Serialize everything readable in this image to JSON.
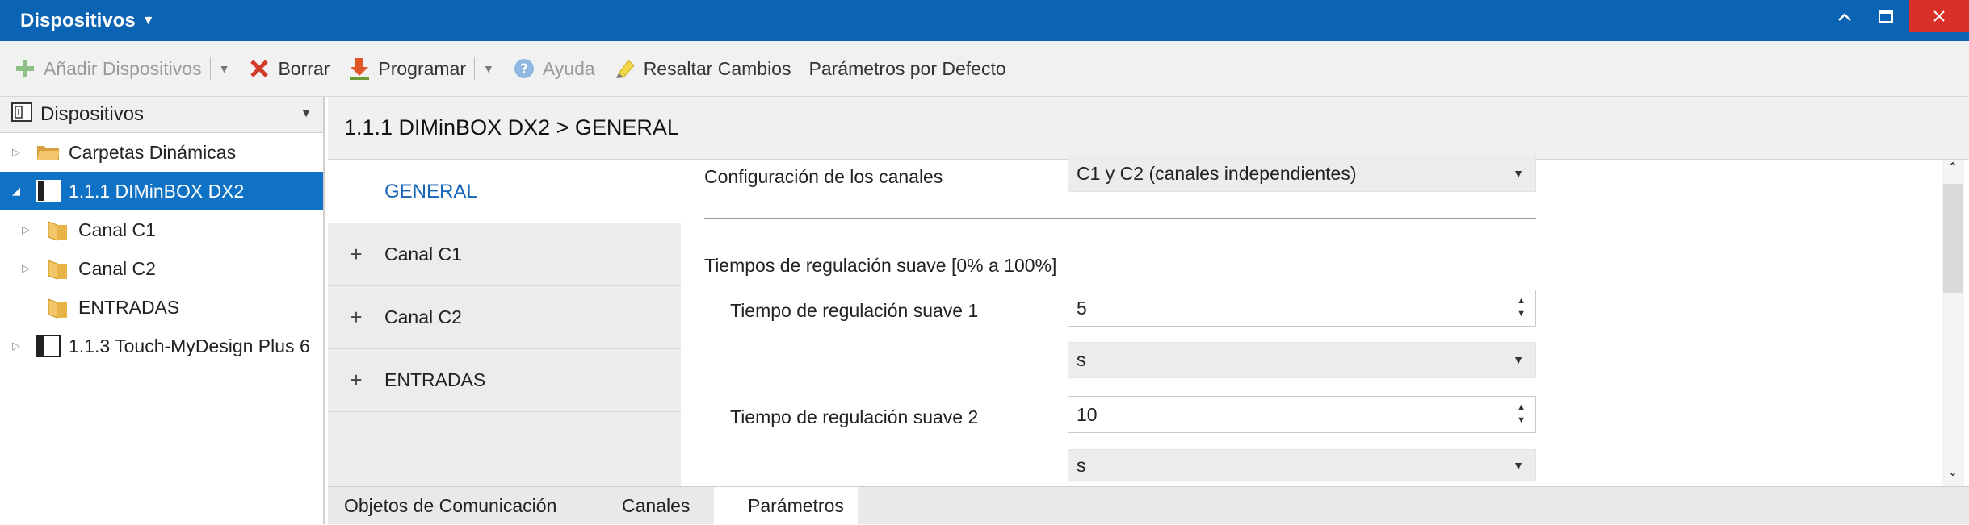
{
  "window": {
    "title": "Dispositivos",
    "controls": {
      "minimize": "⌃",
      "maximize": "☐",
      "close": "✕"
    }
  },
  "toolbar": {
    "add_devices": "Añadir Dispositivos",
    "delete": "Borrar",
    "program": "Programar",
    "help": "Ayuda",
    "highlight_changes": "Resaltar Cambios",
    "default_params": "Parámetros por Defecto"
  },
  "sidebar": {
    "header": "Dispositivos",
    "items": [
      {
        "label": "Carpetas Dinámicas",
        "icon": "folder-open-icon"
      },
      {
        "label": "1.1.1 DIMinBOX DX2",
        "icon": "device-icon",
        "selected": true
      },
      {
        "label": "Canal C1",
        "icon": "folder-icon"
      },
      {
        "label": "Canal C2",
        "icon": "folder-icon"
      },
      {
        "label": "ENTRADAS",
        "icon": "folder-icon"
      },
      {
        "label": "1.1.3 Touch-MyDesign Plus 6",
        "icon": "device-icon"
      }
    ]
  },
  "breadcrumb": "1.1.1 DIMinBOX DX2 > GENERAL",
  "nav": {
    "general": "GENERAL",
    "items": [
      "Canal C1",
      "Canal C2",
      "ENTRADAS"
    ]
  },
  "params": {
    "channels_config_label": "Configuración de los canales",
    "channels_config_value": "C1 y C2 (canales independientes)",
    "soft_dimming_section": "Tiempos de regulación suave [0% a 100%]",
    "soft_time_1_label": "Tiempo de regulación suave 1",
    "soft_time_1_value": "5",
    "soft_time_1_unit": "s",
    "soft_time_2_label": "Tiempo de regulación suave 2",
    "soft_time_2_value": "10",
    "soft_time_2_unit": "s"
  },
  "tabs": {
    "comm_objects": "Objetos de Comunicación",
    "channels": "Canales",
    "parameters": "Parámetros"
  },
  "colors": {
    "titlebar": "#0a63b3",
    "selected": "#1072c4",
    "close": "#d9312a",
    "accent_text": "#1565b8"
  }
}
